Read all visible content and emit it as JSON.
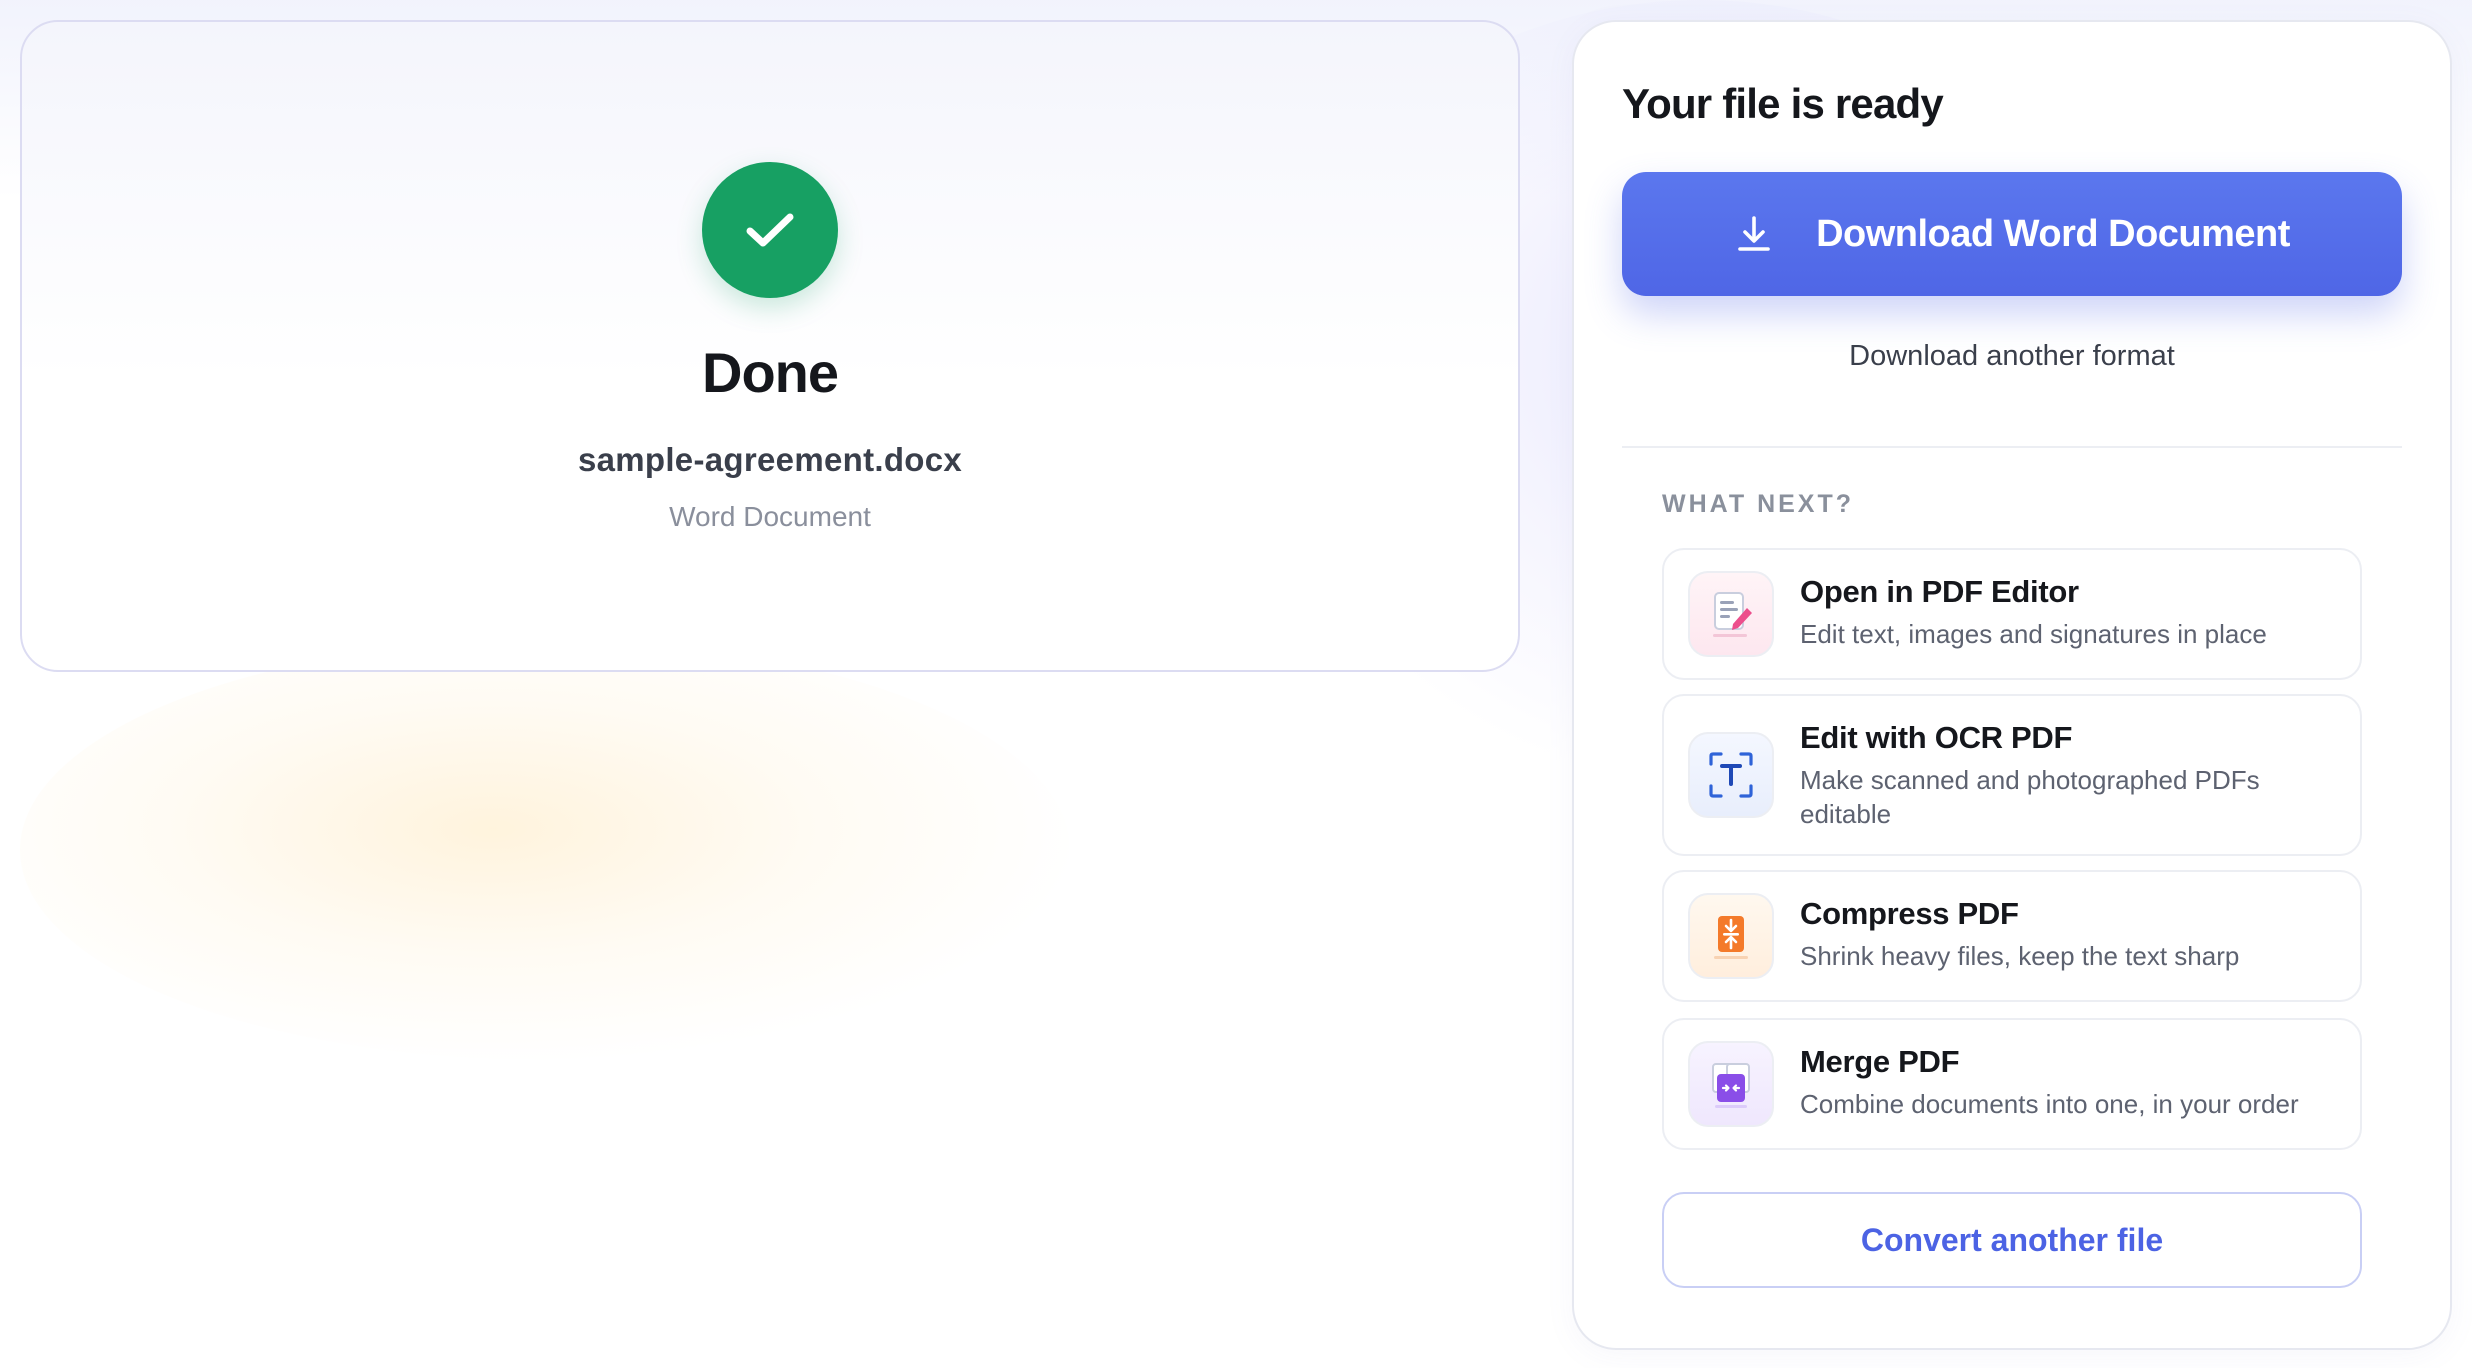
{
  "result": {
    "title": "Done",
    "file_name": "sample-agreement.docx",
    "file_type": "Word Document",
    "check_icon": "check-icon",
    "status_color": "#17a063"
  },
  "panel": {
    "title": "Your file is ready",
    "download_label": "Download Word Document",
    "download_icon": "download-icon",
    "another_format_label": "Download another format",
    "section_label": "WHAT NEXT?",
    "accent_color": "#4f66e6",
    "items": [
      {
        "title": "Open in PDF Editor",
        "desc": "Edit text, images and signatures in place",
        "icon": "pdf-editor-icon"
      },
      {
        "title": "Edit with OCR PDF",
        "desc": "Make scanned and photographed PDFs editable",
        "icon": "ocr-icon"
      },
      {
        "title": "Compress PDF",
        "desc": "Shrink heavy files, keep the text sharp",
        "icon": "compress-icon"
      },
      {
        "title": "Merge PDF",
        "desc": "Combine documents into one, in your order",
        "icon": "merge-icon"
      }
    ],
    "convert_label": "Convert another file"
  }
}
